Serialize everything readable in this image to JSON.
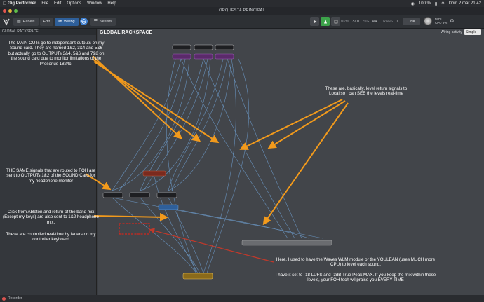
{
  "menubar": {
    "app_name": "Gig Performer",
    "items": [
      "File",
      "Edit",
      "Options",
      "Window",
      "Help"
    ],
    "battery": "100 %",
    "datetime": "Dom 2 mar 21:42"
  },
  "window": {
    "title": "ORQUESTA PRINCIPAL"
  },
  "toolbar": {
    "panels_label": "Panels",
    "edit_label": "Edit",
    "wiring_label": "Wiring",
    "setlists_label": "Setlists",
    "bpm_label": "BPM",
    "bpm_value": "132.0",
    "sig_label": "SIG.",
    "sig_value": "4/4",
    "trans_label": "TRANS.",
    "trans_value": "0",
    "link_label": "LINK",
    "midi_label": "MIDI",
    "cpu_label": "CPU",
    "cpu_value": "8%"
  },
  "left_panel": {
    "header": "GLOBAL RACKSPACE"
  },
  "main": {
    "title": "GLOBAL RACKSPACE",
    "wiring_activity_label": "Wiring activity",
    "wiring_activity_value": "Simple"
  },
  "annotations": {
    "main_outs": "The MAIN OUTs go to independant outputs on my Sound card. They are named 1&2, 3&4 and 5&6 but actually go to OUTPUTs 3&4, 5&6 and 7&8 on the sound card due to monitor limitations of the Presonus 1824c.",
    "level_returns": "These are, basically, level return signals to Local so I can SEE the levels real-time",
    "same_signals": "THE SAME signals that are routed to FOH are sent to OUTPUTs 1&2 of the SOUND Card for my headphone monitor",
    "click": "Click from Ableton and return of the band mix (Except my keys) are also sent to 1&2 headphone mix.",
    "faders": "These are controlled real-time by faders on my controller keyboard",
    "waves": "Here, I used to have the Waves WLM module or the YOULEAN (uses MUCH more CPU) to level each sound.",
    "lufs": "I have it set to -18 LUFS and -3dB True Peak MAX. If you keep the mix within these levels, your FOH tech wil praise you EVERY TIME"
  },
  "statusbar": {
    "recorder_label": "Recorder"
  },
  "colors": {
    "arrow_orange": "#f29a1c",
    "wire_blue": "#6f9fd0",
    "red_box": "#d0281e",
    "red_line": "#c0392b"
  }
}
